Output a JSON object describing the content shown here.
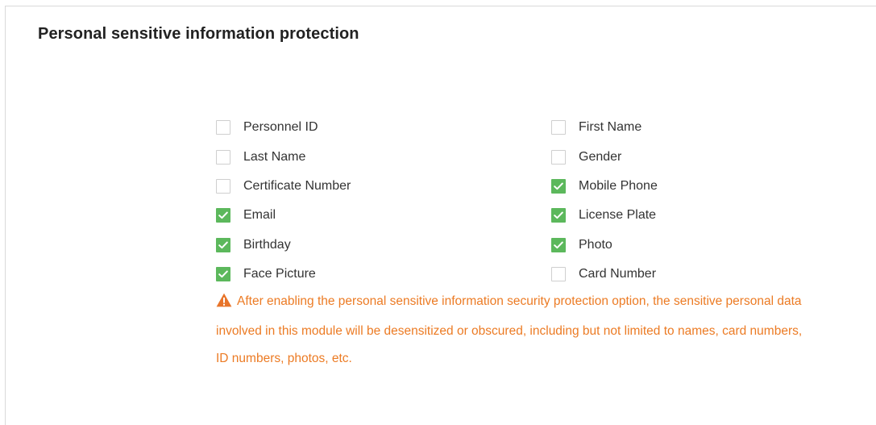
{
  "panel": {
    "title": "Personal sensitive information protection"
  },
  "fields": {
    "left": [
      {
        "label": "Personnel ID",
        "checked": false
      },
      {
        "label": "Last Name",
        "checked": false
      },
      {
        "label": "Certificate Number",
        "checked": false
      },
      {
        "label": "Email",
        "checked": true
      },
      {
        "label": "Birthday",
        "checked": true
      },
      {
        "label": "Face Picture",
        "checked": true
      }
    ],
    "right": [
      {
        "label": "First Name",
        "checked": false
      },
      {
        "label": "Gender",
        "checked": false
      },
      {
        "label": "Mobile Phone",
        "checked": true
      },
      {
        "label": "License Plate",
        "checked": true
      },
      {
        "label": "Photo",
        "checked": true
      },
      {
        "label": "Card Number",
        "checked": false
      }
    ]
  },
  "notice": {
    "icon": "warning-triangle-icon",
    "text": "After enabling the personal sensitive information security protection option, the sensitive personal data involved in this module will be desensitized or obscured, including but not limited to names, card numbers, ID numbers, photos, etc."
  },
  "colors": {
    "checked": "#5cb85c",
    "warning": "#ec7b24",
    "border": "#d9d9d9"
  }
}
